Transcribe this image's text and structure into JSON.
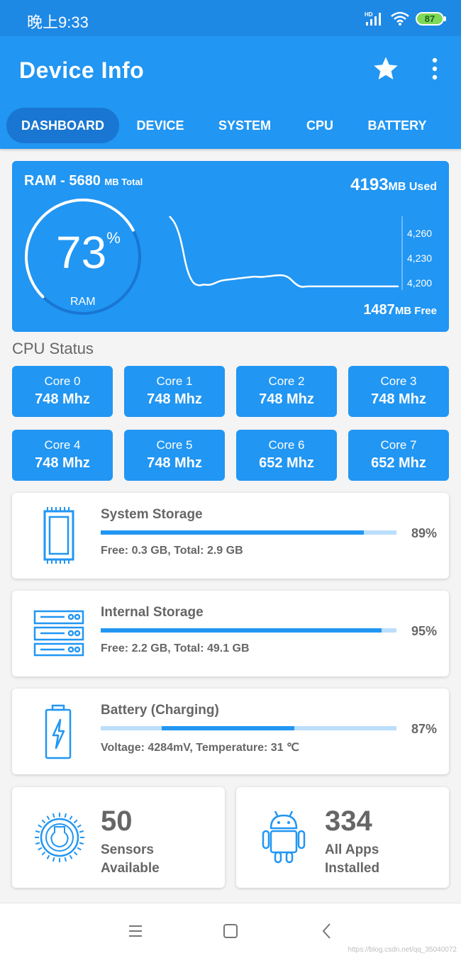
{
  "status_bar": {
    "time": "晚上9:33",
    "network_label": "HD",
    "battery_level": "87",
    "battery_color": "#7ed957"
  },
  "app_bar": {
    "title": "Device Info",
    "star_icon": "star-icon",
    "more_icon": "more-vert-icon"
  },
  "tabs": [
    {
      "label": "DASHBOARD",
      "active": true
    },
    {
      "label": "DEVICE",
      "active": false
    },
    {
      "label": "SYSTEM",
      "active": false
    },
    {
      "label": "CPU",
      "active": false
    },
    {
      "label": "BATTERY",
      "active": false
    }
  ],
  "ram": {
    "title": "RAM - 5680",
    "title_unit": "MB Total",
    "used_value": "4193",
    "used_unit": "MB Used",
    "free_value": "1487",
    "free_unit": "MB Free",
    "percent": "73",
    "percent_sign": "%",
    "gauge_fraction": 0.73,
    "gauge_label": "RAM"
  },
  "chart_data": {
    "type": "line",
    "title": "",
    "xlabel": "",
    "ylabel": "",
    "y_ticks": [
      "4,260",
      "4,230",
      "4,200"
    ],
    "ylim": [
      4180,
      4300
    ],
    "grid": false,
    "series": [
      {
        "values": [
          4300,
          4290,
          4265,
          4220,
          4200,
          4195,
          4197,
          4196,
          4199,
          4203,
          4204,
          4205,
          4206,
          4207,
          4208,
          4209,
          4208,
          4209,
          4210,
          4211,
          4211,
          4207,
          4198,
          4193,
          4194,
          4194,
          4194,
          4194,
          4194,
          4194,
          4194,
          4194,
          4194,
          4194,
          4194,
          4194,
          4194,
          4194,
          4194,
          4194,
          4194
        ]
      }
    ]
  },
  "cpu": {
    "title": "CPU Status",
    "cores": [
      {
        "name": "Core 0",
        "freq": "748 Mhz"
      },
      {
        "name": "Core 1",
        "freq": "748 Mhz"
      },
      {
        "name": "Core 2",
        "freq": "748 Mhz"
      },
      {
        "name": "Core 3",
        "freq": "748 Mhz"
      },
      {
        "name": "Core 4",
        "freq": "748 Mhz"
      },
      {
        "name": "Core 5",
        "freq": "748 Mhz"
      },
      {
        "name": "Core 6",
        "freq": "652 Mhz"
      },
      {
        "name": "Core 7",
        "freq": "652 Mhz"
      }
    ]
  },
  "system_storage": {
    "title": "System Storage",
    "detail": "Free: 0.3 GB,  Total: 2.9 GB",
    "percent_label": "89%",
    "fraction": 0.89,
    "icon": "sd-card-icon"
  },
  "internal_storage": {
    "title": "Internal Storage",
    "detail": "Free: 2.2 GB,  Total: 49.1 GB",
    "percent_label": "95%",
    "fraction": 0.95,
    "icon": "server-icon"
  },
  "battery": {
    "title": "Battery (Charging)",
    "detail": "Voltage: 4284mV,  Temperature: 31 ℃",
    "percent_label": "87%",
    "icon": "battery-charging-icon"
  },
  "sensors": {
    "count": "50",
    "label": "Sensors Available",
    "icon": "sensor-icon"
  },
  "apps": {
    "count": "334",
    "label": "All Apps Installed",
    "icon": "android-icon"
  },
  "nav_bar": {
    "menu_icon": "menu-icon",
    "home_icon": "home-square-icon",
    "back_icon": "back-chevron-icon"
  },
  "watermark": "https://blog.csdn.net/qq_35040072",
  "colors": {
    "primary": "#2196f3",
    "primary_dark": "#1976d2",
    "status_bar": "#1e88e5",
    "track": "#bbdefb"
  }
}
